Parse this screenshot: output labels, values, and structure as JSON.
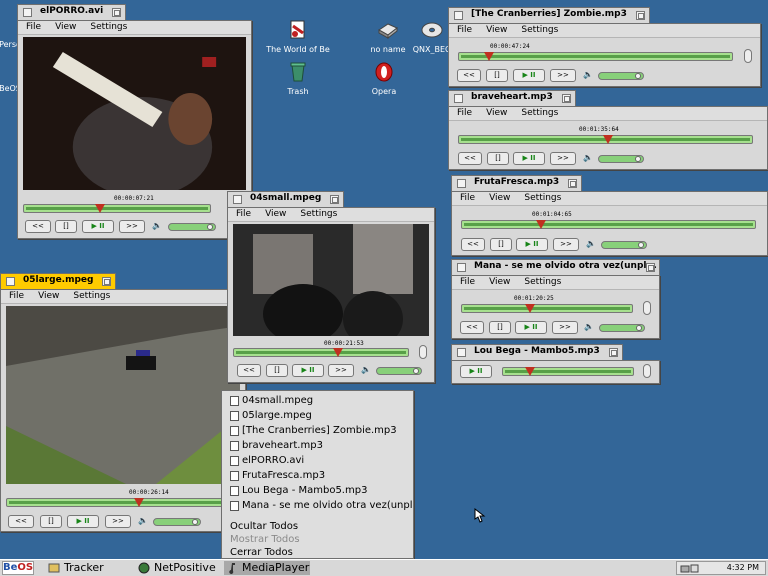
{
  "desktop": {
    "icons": [
      {
        "label": "The World of Be",
        "icon": "world-of-be-icon"
      },
      {
        "label": "no name",
        "icon": "disk-icon"
      },
      {
        "label": "QNX_BEO",
        "icon": "cd-icon"
      },
      {
        "label": "Trash",
        "icon": "trash-icon"
      },
      {
        "label": "Opera",
        "icon": "opera-icon"
      },
      {
        "label": "Perso",
        "icon": "folder-icon"
      },
      {
        "label": "BeOS",
        "icon": "volume-icon"
      }
    ]
  },
  "menus": {
    "file": "File",
    "view": "View",
    "settings": "Settings"
  },
  "controls": {
    "rewind": "<<",
    "stop": "[]",
    "play": "▶ II",
    "forward": ">>"
  },
  "windows": {
    "elporro": {
      "title": "elPORRO.avi",
      "time": "00:00:07:21",
      "position": 0.41
    },
    "small04": {
      "title": "04small.mpeg",
      "time": "00:00:21:53",
      "position": 0.6
    },
    "large05": {
      "title": "05large.mpeg",
      "time": "00:00:26:14",
      "position": 0.6
    },
    "zombie": {
      "title": "[The Cranberries] Zombie.mp3",
      "time": "00:00:47:24",
      "position": 0.11
    },
    "braveheart": {
      "title": "braveheart.mp3",
      "time": "00:01:35:64",
      "position": 0.51
    },
    "frutafresca": {
      "title": "FrutaFresca.mp3",
      "time": "00:01:04:65",
      "position": 0.27
    },
    "mana": {
      "title": "Mana - se me olvido otra vez(unpl...",
      "time": "00:01:20:25",
      "position": 0.4
    },
    "loubega": {
      "title": "Lou Bega - Mambo5.mp3",
      "position": 0.21
    }
  },
  "popup": {
    "items": [
      "04small.mpeg",
      "05large.mpeg",
      "[The Cranberries] Zombie.mp3",
      "braveheart.mp3",
      "elPORRO.avi",
      "FrutaFresca.mp3",
      "Lou Bega - Mambo5.mp3",
      "Mana - se me olvido otra vez(unpl"
    ],
    "hide_all": "Ocultar Todos",
    "show_all": "Mostrar Todos",
    "close_all": "Cerrar Todos"
  },
  "deskbar": {
    "logo_be": "Be",
    "logo_os": "OS",
    "tasks": [
      "Tracker",
      "NetPositive",
      "MediaPlayer"
    ],
    "clock": "4:32 PM"
  },
  "colors": {
    "desktop": "#336698",
    "active_tab": "#ffcb00",
    "progress": "#a6e08e",
    "play_glyph": "#178417"
  }
}
